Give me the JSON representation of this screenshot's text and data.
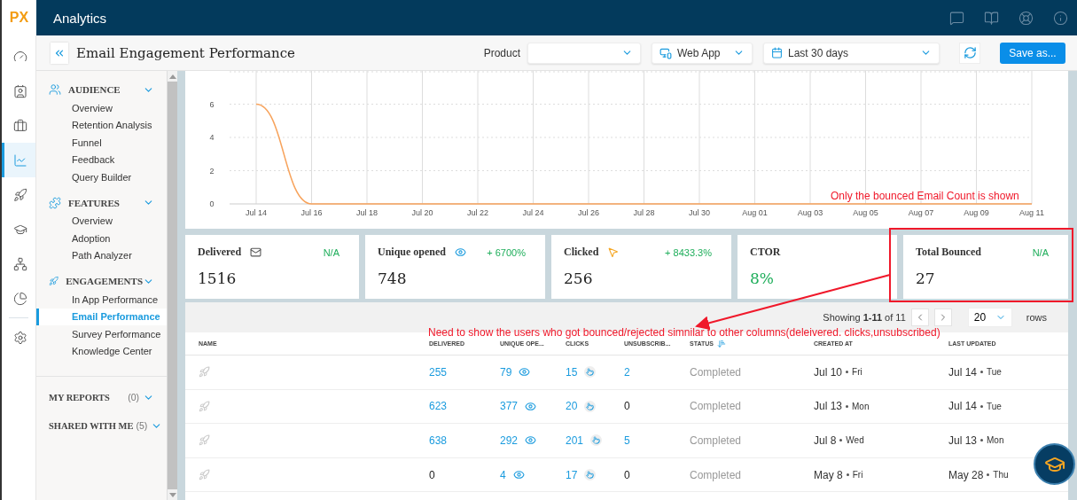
{
  "app": {
    "logo": "PX",
    "title": "Analytics"
  },
  "header_icons": [
    {
      "kind": "chat"
    },
    {
      "kind": "book"
    },
    {
      "kind": "help"
    },
    {
      "kind": "info"
    }
  ],
  "rail": [
    {
      "kind": "gauge",
      "selected": false
    },
    {
      "kind": "contact",
      "selected": false
    },
    {
      "kind": "briefcase",
      "selected": false
    },
    {
      "kind": "chart",
      "selected": true
    },
    {
      "kind": "rocket",
      "selected": false
    },
    {
      "kind": "cap",
      "selected": false
    },
    {
      "kind": "tree",
      "selected": false
    },
    {
      "kind": "pie",
      "selected": false
    },
    {
      "kind": "settings",
      "selected": false
    }
  ],
  "page": {
    "title": "Email Engagement Performance"
  },
  "filters": {
    "product_label": "Product",
    "platform": "Web App",
    "date_range": "Last 30 days",
    "save_button": "Save as..."
  },
  "sidebar": {
    "sections": [
      {
        "title": "AUDIENCE",
        "expanded": true,
        "items": [
          {
            "label": "Overview",
            "selected": false
          },
          {
            "label": "Retention Analysis",
            "selected": false
          },
          {
            "label": "Funnel",
            "selected": false
          },
          {
            "label": "Feedback",
            "selected": false
          },
          {
            "label": "Query Builder",
            "selected": false
          }
        ]
      },
      {
        "title": "FEATURES",
        "expanded": true,
        "items": [
          {
            "label": "Overview",
            "selected": false
          },
          {
            "label": "Adoption",
            "selected": false
          },
          {
            "label": "Path Analyzer",
            "selected": false
          }
        ]
      },
      {
        "title": "ENGAGEMENTS",
        "expanded": true,
        "items": [
          {
            "label": "In App Performance",
            "selected": false
          },
          {
            "label": "Email Performance",
            "selected": true
          },
          {
            "label": "Survey Performance",
            "selected": false
          },
          {
            "label": "Knowledge Center",
            "selected": false
          }
        ]
      }
    ],
    "reports": [
      {
        "title": "MY REPORTS",
        "count": "(0)"
      },
      {
        "title": "SHARED WITH ME",
        "count": "(5)"
      }
    ]
  },
  "chart": {
    "chart_data": {
      "type": "line",
      "grid": true,
      "categories": [
        "Jul 14",
        "Jul 16",
        "Jul 18",
        "Jul 20",
        "Jul 22",
        "Jul 24",
        "Jul 26",
        "Jul 28",
        "Jul 30",
        "Aug 01",
        "Aug 03",
        "Aug 05",
        "Aug 07",
        "Aug 09",
        "Aug 11"
      ],
      "series": [
        {
          "color": "#f7a35c",
          "values": [
            6,
            0,
            0,
            0,
            0,
            0,
            0,
            0,
            0,
            0,
            0,
            0,
            0,
            0,
            0
          ]
        }
      ],
      "ylim": [
        0,
        8
      ],
      "yticks": [
        0,
        2,
        4,
        6
      ]
    }
  },
  "metrics": [
    {
      "label": "Delivered",
      "change": "N/A",
      "value": "1516",
      "positive": false
    },
    {
      "label": "Unique opened",
      "change": "+ 6700%",
      "value": "748",
      "positive": false
    },
    {
      "label": "Clicked",
      "change": "+ 8433.3%",
      "value": "256",
      "positive": false
    },
    {
      "label": "CTOR",
      "value": "8%",
      "positive": true
    },
    {
      "label": "Total Bounced",
      "change": "N/A",
      "value": "27",
      "positive": false
    }
  ],
  "table": {
    "showing": "Showing **1-11** of 11",
    "page_size": "20",
    "rows_label": "rows",
    "columns": [
      {
        "label": "NAME",
        "sorted": false
      },
      {
        "label": "DELIVERED",
        "sorted": false
      },
      {
        "label": "UNIQUE OPE...",
        "sorted": false
      },
      {
        "label": "CLICKS",
        "sorted": false
      },
      {
        "label": "UNSUBSCRIB...",
        "sorted": false
      },
      {
        "label": "STATUS",
        "sorted": true
      },
      {
        "label": "CREATED AT",
        "sorted": false
      },
      {
        "label": "LAST UPDATED",
        "sorted": false
      }
    ],
    "rows": [
      {
        "delivered": {
          "text": "255",
          "link": true
        },
        "opened": {
          "text": "79",
          "link": true
        },
        "clicks": {
          "text": "15",
          "link": true
        },
        "unsubscribed": {
          "text": "2",
          "link": true
        },
        "status": "Completed",
        "created": {
          "date": "Jul 10",
          "day": "Fri"
        },
        "updated": {
          "date": "Jul 14",
          "day": "Tue"
        }
      },
      {
        "delivered": {
          "text": "623",
          "link": true
        },
        "opened": {
          "text": "377",
          "link": true
        },
        "clicks": {
          "text": "20",
          "link": true
        },
        "unsubscribed": {
          "text": "0",
          "link": false
        },
        "status": "Completed",
        "created": {
          "date": "Jul 13",
          "day": "Mon"
        },
        "updated": {
          "date": "Jul 14",
          "day": "Tue"
        }
      },
      {
        "delivered": {
          "text": "638",
          "link": true
        },
        "opened": {
          "text": "292",
          "link": true
        },
        "clicks": {
          "text": "201",
          "link": true
        },
        "unsubscribed": {
          "text": "5",
          "link": true
        },
        "status": "Completed",
        "created": {
          "date": "Jul 8",
          "day": "Wed"
        },
        "updated": {
          "date": "Jul 13",
          "day": "Mon"
        }
      },
      {
        "delivered": {
          "text": "0",
          "link": false
        },
        "opened": {
          "text": "4",
          "link": true
        },
        "clicks": {
          "text": "17",
          "link": true
        },
        "unsubscribed": {
          "text": "0",
          "link": false
        },
        "status": "Completed",
        "created": {
          "date": "May 8",
          "day": "Fri"
        },
        "updated": {
          "date": "May 28",
          "day": "Thu"
        }
      }
    ]
  },
  "annotations": [
    {
      "text": "Only the bounced Email Count is shown"
    },
    {
      "text": "Need to show the users who got bounced/rejected simnilar to other columns(deleivered. clicks,unsubscribed)"
    }
  ]
}
